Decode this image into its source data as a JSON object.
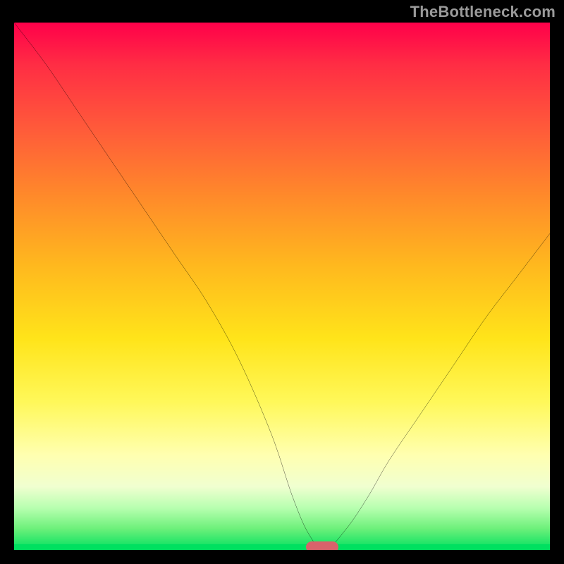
{
  "watermark": "TheBottleneck.com",
  "chart_data": {
    "type": "line",
    "title": "",
    "xlabel": "",
    "ylabel": "",
    "xlim": [
      0,
      100
    ],
    "ylim": [
      0,
      100
    ],
    "grid": false,
    "legend": false,
    "series": [
      {
        "name": "bottleneck-curve",
        "x": [
          0,
          6,
          12,
          18,
          24,
          30,
          36,
          42,
          48,
          52,
          55,
          58,
          62,
          66,
          70,
          76,
          82,
          88,
          94,
          100
        ],
        "values": [
          100,
          92,
          83,
          74,
          65,
          56,
          47,
          36,
          22,
          10,
          3,
          0,
          4,
          10,
          17,
          26,
          35,
          44,
          52,
          60
        ]
      }
    ],
    "optimum_marker": {
      "x": 57.5,
      "y": 0
    },
    "background_gradient": {
      "stops": [
        {
          "pos": 0.0,
          "color": "#ff004a"
        },
        {
          "pos": 0.2,
          "color": "#ff5a3a"
        },
        {
          "pos": 0.46,
          "color": "#ffb81e"
        },
        {
          "pos": 0.72,
          "color": "#fff85a"
        },
        {
          "pos": 0.88,
          "color": "#f0ffd0"
        },
        {
          "pos": 1.0,
          "color": "#00e060"
        }
      ]
    }
  }
}
